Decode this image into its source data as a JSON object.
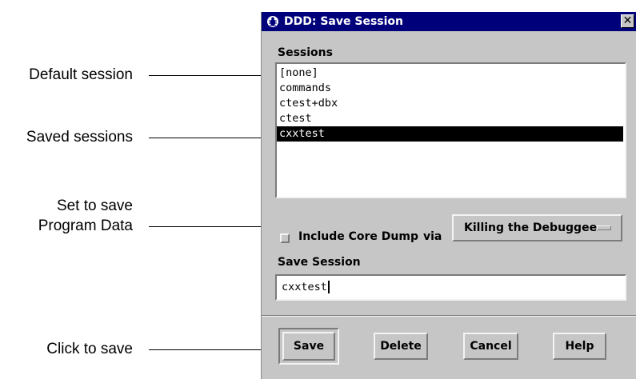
{
  "callouts": {
    "default_session": "Default session",
    "saved_sessions": "Saved sessions",
    "program_data_line1": "Set to save",
    "program_data_line2": "Program Data",
    "click_to_save": "Click to save"
  },
  "window": {
    "title": "DDD: Save Session",
    "title_icon": "ddd-bug-icon",
    "close_label": "✕",
    "close_icon": "close-icon"
  },
  "sessions": {
    "label": "Sessions",
    "items": [
      "[none]",
      "commands",
      "ctest+dbx",
      "ctest",
      "cxxtest"
    ],
    "selected": "cxxtest"
  },
  "core_dump": {
    "checkbox_label": "Include Core Dump",
    "checked": false,
    "via_label": "via",
    "method": "Killing the Debuggee"
  },
  "save_session": {
    "label": "Save Session",
    "value": "cxxtest"
  },
  "buttons": {
    "save": "Save",
    "delete": "Delete",
    "cancel": "Cancel",
    "help": "Help"
  },
  "colors": {
    "titlebar": "#00007b",
    "dialog_bg": "#c6c6c6",
    "selection": "#000000"
  }
}
